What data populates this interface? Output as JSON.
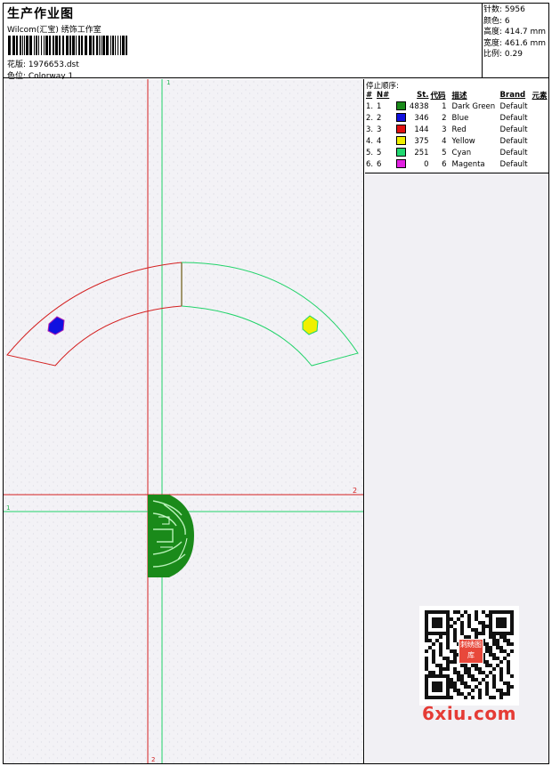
{
  "header": {
    "title": "生产作业图",
    "subtitle": "Wilcom(汇宝) 绣饰工作室",
    "file_label": "花版: 1976653.dst",
    "colorway_label": "色位: Colorway 1"
  },
  "stats": {
    "stitches": "针数: 5956",
    "colors": "颜色: 6",
    "height": "高度: 414.7 mm",
    "width": "宽度: 461.6 mm",
    "scale": "比例: 0.29"
  },
  "sequence": {
    "caption": "停止顺序:",
    "headers": [
      "#",
      "N#",
      "St.",
      "代码",
      "描述",
      "Brand",
      "元素"
    ],
    "rows": [
      {
        "idx": "1.",
        "n": "1",
        "color": "#1a8a1a",
        "st": "4838",
        "code": "1",
        "desc": "Dark Green",
        "brand": "Default"
      },
      {
        "idx": "2.",
        "n": "2",
        "color": "#1010e0",
        "st": "346",
        "code": "2",
        "desc": "Blue",
        "brand": "Default"
      },
      {
        "idx": "3.",
        "n": "3",
        "color": "#e01010",
        "st": "144",
        "code": "3",
        "desc": "Red",
        "brand": "Default"
      },
      {
        "idx": "4.",
        "n": "4",
        "color": "#f0f000",
        "st": "375",
        "code": "4",
        "desc": "Yellow",
        "brand": "Default"
      },
      {
        "idx": "5.",
        "n": "5",
        "color": "#20d870",
        "st": "251",
        "code": "5",
        "desc": "Cyan",
        "brand": "Default"
      },
      {
        "idx": "6.",
        "n": "6",
        "color": "#e020e0",
        "st": "0",
        "code": "6",
        "desc": "Magenta",
        "brand": "Default"
      }
    ]
  },
  "canvas": {
    "marker_top": "1",
    "marker_bottom": "2",
    "marker_left": "1",
    "marker_right": "2",
    "colors": {
      "red_line": "#d42020",
      "green_line": "#22d36a",
      "dark_green": "#1a8a1a",
      "blue": "#1010e0",
      "yellow": "#f0f000",
      "olive": "#6b5a10"
    }
  },
  "watermark": {
    "seal_text": "刺绣图库",
    "logo_text": "6xiu.com"
  }
}
